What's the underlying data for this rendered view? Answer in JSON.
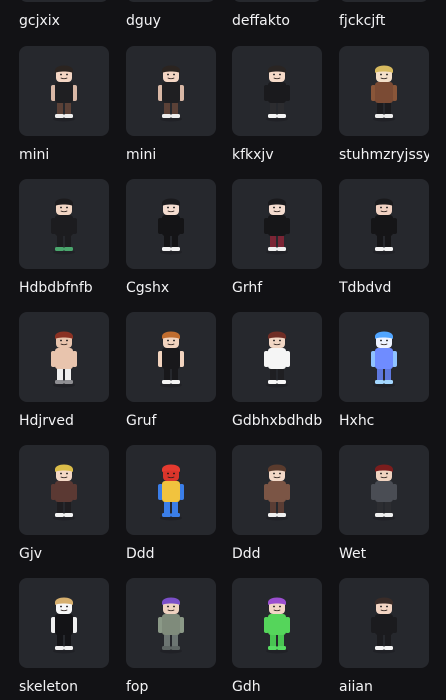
{
  "top_row": [
    "gcjxix",
    "dguy",
    "deffakto",
    "fjckcjft"
  ],
  "rows": [
    [
      {
        "name": "mini",
        "avatar": {
          "hair": "#2b2420",
          "skin": "#f4d6c4",
          "torso": "#1f1f22",
          "arms": "#d9b8a6",
          "legs": "#5b4137",
          "shoes": "#eeeeee"
        }
      },
      {
        "name": "mini",
        "avatar": {
          "hair": "#2b2420",
          "skin": "#f4d6c4",
          "torso": "#1f1f22",
          "arms": "#d9b8a6",
          "legs": "#5b4137",
          "shoes": "#eeeeee"
        }
      },
      {
        "name": "kfkxjv",
        "avatar": {
          "hair": "#2a2523",
          "skin": "#f5dac8",
          "torso": "#1a1a1d",
          "arms": "#1a1a1d",
          "legs": "#2c2c2f",
          "shoes": "#f4f4f4"
        }
      },
      {
        "name": "stuhmzryjssy",
        "avatar": {
          "hair": "#d7ba5f",
          "skin": "#f3dfc9",
          "torso": "#7b4b34",
          "arms": "#8a5639",
          "legs": "#1b1b1e",
          "shoes": "#ececec"
        }
      }
    ],
    [
      {
        "name": "Hdbdbfnfb",
        "avatar": {
          "hair": "#1c1b1d",
          "skin": "#f2d6c4",
          "torso": "#1c1c1f",
          "arms": "#1c1c1f",
          "legs": "#1c1c1f",
          "shoes": "#4aa66d"
        }
      },
      {
        "name": "Cgshx",
        "avatar": {
          "hair": "#1a1a1d",
          "skin": "#f5ddd0",
          "torso": "#141416",
          "arms": "#141416",
          "legs": "#141416",
          "shoes": "#f2f2f2"
        }
      },
      {
        "name": "Grhf",
        "avatar": {
          "hair": "#1a1a1d",
          "skin": "#f4dccf",
          "torso": "#161618",
          "arms": "#161618",
          "legs": "#7b2535",
          "shoes": "#f0f0f0"
        }
      },
      {
        "name": "Tdbdvd",
        "avatar": {
          "hair": "#1a1a1c",
          "skin": "#f1d2c2",
          "torso": "#151517",
          "arms": "#151517",
          "legs": "#151517",
          "shoes": "#f5f5f5"
        }
      }
    ],
    [
      {
        "name": "Hdjrved",
        "avatar": {
          "hair": "#8a3123",
          "skin": "#e8c4ad",
          "torso": "#e8c4ad",
          "arms": "#e8c4ad",
          "legs": "#efefef",
          "shoes": "#8f8f93"
        }
      },
      {
        "name": "Gruf",
        "avatar": {
          "hair": "#c06d2f",
          "skin": "#f2d4bf",
          "torso": "#18181b",
          "arms": "#f2d4bf",
          "legs": "#18181b",
          "shoes": "#f3f3f3"
        }
      },
      {
        "name": "Gdbhxbdhdb",
        "avatar": {
          "hair": "#6f2d25",
          "skin": "#f1d7c5",
          "torso": "#f5f5f5",
          "arms": "#f5f5f5",
          "legs": "#1f1f22",
          "shoes": "#f7f7f7"
        }
      },
      {
        "name": "Hxhc",
        "avatar": {
          "hair": "#50a5ff",
          "skin": "#eef3ff",
          "torso": "#6f8cff",
          "arms": "#8fc2ff",
          "legs": "#5e78de",
          "shoes": "#a4d7ff"
        }
      }
    ],
    [
      {
        "name": "Gjv",
        "avatar": {
          "hair": "#dbbd49",
          "skin": "#f3d8c6",
          "torso": "#5b3933",
          "arms": "#5b3933",
          "legs": "#1e1d20",
          "shoes": "#f2f2f2"
        }
      },
      {
        "name": "Ddd",
        "avatar": {
          "hair": "#e53a2f",
          "skin": "#d9352b",
          "torso": "#f1c33e",
          "arms": "#3b7ee8",
          "legs": "#3b7ee8",
          "shoes": "#3b7ee8"
        }
      },
      {
        "name": "Ddd",
        "avatar": {
          "hair": "#5a3b2d",
          "skin": "#f2d8c7",
          "torso": "#7b5545",
          "arms": "#7b5545",
          "legs": "#5a3d34",
          "shoes": "#efefef"
        }
      },
      {
        "name": "Wet",
        "avatar": {
          "hair": "#7b1d1d",
          "skin": "#efd3c0",
          "torso": "#4a4d54",
          "arms": "#4a4d54",
          "legs": "#2c2d31",
          "shoes": "#efefef"
        }
      }
    ],
    [
      {
        "name": "skeleton",
        "avatar": {
          "hair": "#d7b06f",
          "skin": "#f7f7f7",
          "torso": "#131316",
          "arms": "#f0f0f0",
          "legs": "#131316",
          "shoes": "#f0f0f0"
        }
      },
      {
        "name": "fop",
        "avatar": {
          "hair": "#7b4fc8",
          "skin": "#efd2c0",
          "torso": "#7f8b7b",
          "arms": "#8b9987",
          "legs": "#6c7572",
          "shoes": "#5e6664"
        }
      },
      {
        "name": "Gdh",
        "avatar": {
          "hair": "#9b4ed0",
          "skin": "#f2d5c6",
          "torso": "#55d55b",
          "arms": "#55d55b",
          "legs": "#49c552",
          "shoes": "#57dc62"
        }
      },
      {
        "name": "aiian",
        "avatar": {
          "hair": "#3a2c28",
          "skin": "#f3d5c3",
          "torso": "#1b1b1e",
          "arms": "#1b1b1e",
          "legs": "#1b1b1e",
          "shoes": "#f4f4f4"
        }
      }
    ]
  ]
}
